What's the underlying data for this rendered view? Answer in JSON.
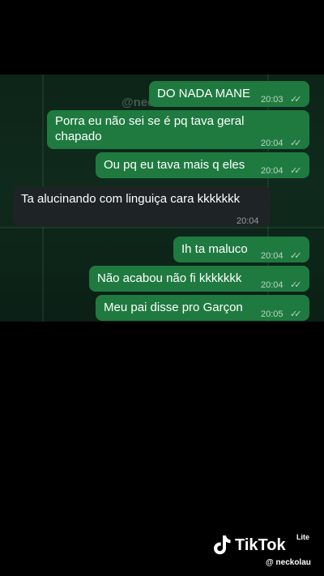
{
  "watermark": "@neckolau",
  "messages": [
    {
      "text": "DO NADA MANE",
      "time": "20:03",
      "ticks": "✓✓"
    },
    {
      "text_line1": "Porra eu não sei se é pq tava geral",
      "text_line2": "chapado",
      "time": "20:04",
      "ticks": "✓✓"
    },
    {
      "text": "Ou pq eu tava mais q eles",
      "time": "20:04",
      "ticks": "✓✓"
    },
    {
      "text": "Ta alucinando com linguiça cara kkkkkkk",
      "time": "20:04"
    },
    {
      "text": "Ih ta maluco",
      "time": "20:04",
      "ticks": "✓✓"
    },
    {
      "text": "Não acabou não fi kkkkkkk",
      "time": "20:04",
      "ticks": "✓✓"
    },
    {
      "text": "Meu pai disse pro Garçon",
      "time": "20:05",
      "ticks": "✓✓"
    }
  ],
  "tiktok": {
    "brand": "TikTok",
    "lite": "Lite",
    "handle": "@ neckolau"
  },
  "colors": {
    "outgoing": "#1f7a40",
    "incoming": "#1e2326",
    "background": "#000000"
  }
}
